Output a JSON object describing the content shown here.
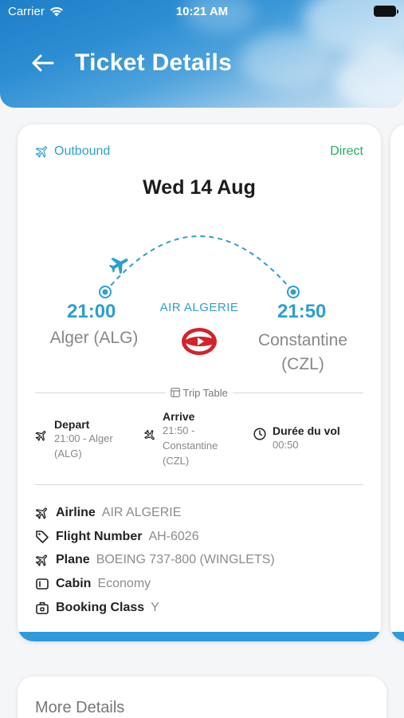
{
  "status_bar": {
    "carrier": "Carrier",
    "time": "10:21 AM"
  },
  "header": {
    "title": "Ticket Details"
  },
  "ticket": {
    "direction_label": "Outbound",
    "stops_label": "Direct",
    "date": "Wed 14 Aug",
    "departure": {
      "time": "21:00",
      "city": "Alger (ALG)"
    },
    "arrival": {
      "time": "21:50",
      "city": "Constantine (CZL)"
    },
    "airline_label": "AIR ALGERIE",
    "trip_table_label": "Trip Table",
    "trip_table": {
      "depart": {
        "label": "Depart",
        "value": "21:00 - Alger (ALG)"
      },
      "arrive": {
        "label": "Arrive",
        "value": "21:50 - Constantine (CZL)"
      },
      "duration": {
        "label": "Durée du vol",
        "value": "00:50"
      }
    },
    "details": [
      {
        "icon": "airplane-icon",
        "label": "Airline",
        "value": "AIR ALGERIE"
      },
      {
        "icon": "tag-icon",
        "label": "Flight Number",
        "value": "AH-6026"
      },
      {
        "icon": "airplane-icon",
        "label": "Plane",
        "value": "BOEING 737-800 (WINGLETS)"
      },
      {
        "icon": "seat-icon",
        "label": "Cabin",
        "value": "Economy"
      },
      {
        "icon": "luggage-icon",
        "label": "Booking Class",
        "value": "Y"
      }
    ]
  },
  "more_details": {
    "title": "More Details"
  },
  "colors": {
    "accent": "#2d9fd0",
    "direct": "#27ae60",
    "logo_red": "#d2232a"
  }
}
